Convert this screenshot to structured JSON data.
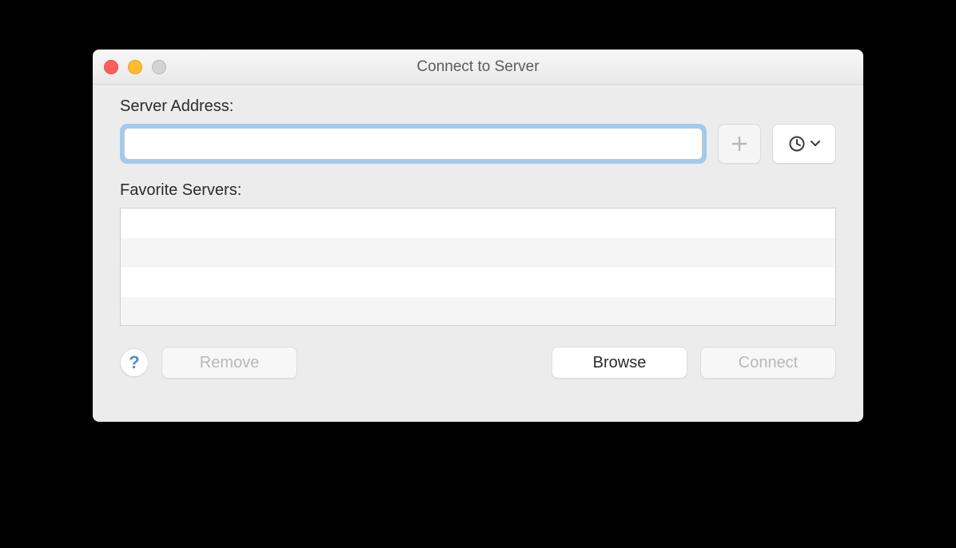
{
  "window": {
    "title": "Connect to Server"
  },
  "labels": {
    "server_address": "Server Address:",
    "favorite_servers": "Favorite Servers:"
  },
  "inputs": {
    "server_address": {
      "value": "",
      "placeholder": ""
    }
  },
  "buttons": {
    "remove": "Remove",
    "browse": "Browse",
    "connect": "Connect",
    "help": "?"
  },
  "icons": {
    "add": "plus-icon",
    "history": "clock-icon",
    "chevron": "chevron-down-icon"
  },
  "favorites": {
    "items": []
  }
}
